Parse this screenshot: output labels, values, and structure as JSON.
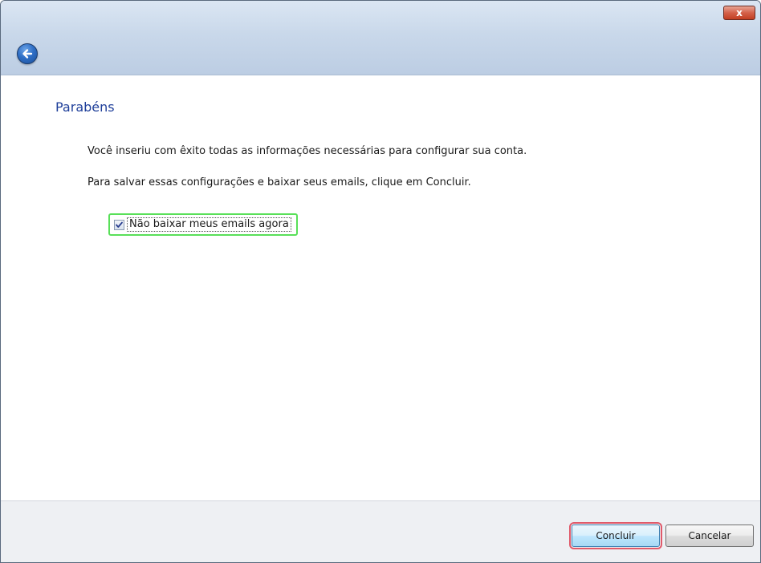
{
  "window": {
    "close_label": "x",
    "back_icon": "back-arrow-icon"
  },
  "main": {
    "heading": "Parabéns",
    "paragraph1": "Você inseriu com êxito todas as informações necessárias para configurar sua conta.",
    "paragraph2": "Para salvar essas configurações e baixar seus emails, clique em Concluir.",
    "checkbox": {
      "label": "Não baixar meus emails agora",
      "checked": true
    }
  },
  "footer": {
    "finish_label": "Concluir",
    "cancel_label": "Cancelar"
  },
  "colors": {
    "heading": "#1f3f9a",
    "checkbox_highlight": "#59e059",
    "finish_highlight": "#e05a6a"
  }
}
